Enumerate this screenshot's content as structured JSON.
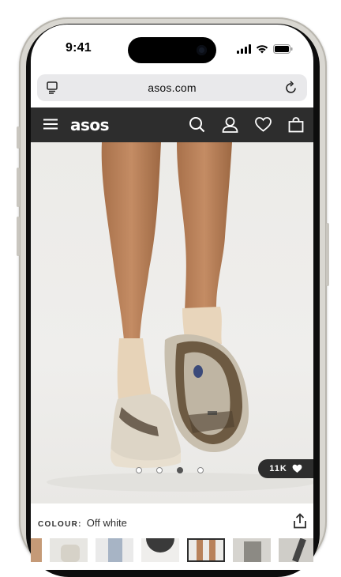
{
  "status": {
    "time": "9:41"
  },
  "browser": {
    "url": "asos.com"
  },
  "nav": {
    "logo": "asos"
  },
  "product": {
    "likes": "11K",
    "colour_label": "COLOUR:",
    "colour_value": "Off white",
    "gallery_dots": 4,
    "active_dot": 2
  },
  "icons": {
    "tabs": "tabs-icon",
    "reload": "reload-icon",
    "menu": "menu-icon",
    "search": "search-icon",
    "account": "account-icon",
    "saved": "heart-icon",
    "bag": "bag-icon",
    "share": "share-icon"
  },
  "colors": {
    "nav_bg": "#2d2d2d",
    "page_bg": "#ffffff"
  }
}
